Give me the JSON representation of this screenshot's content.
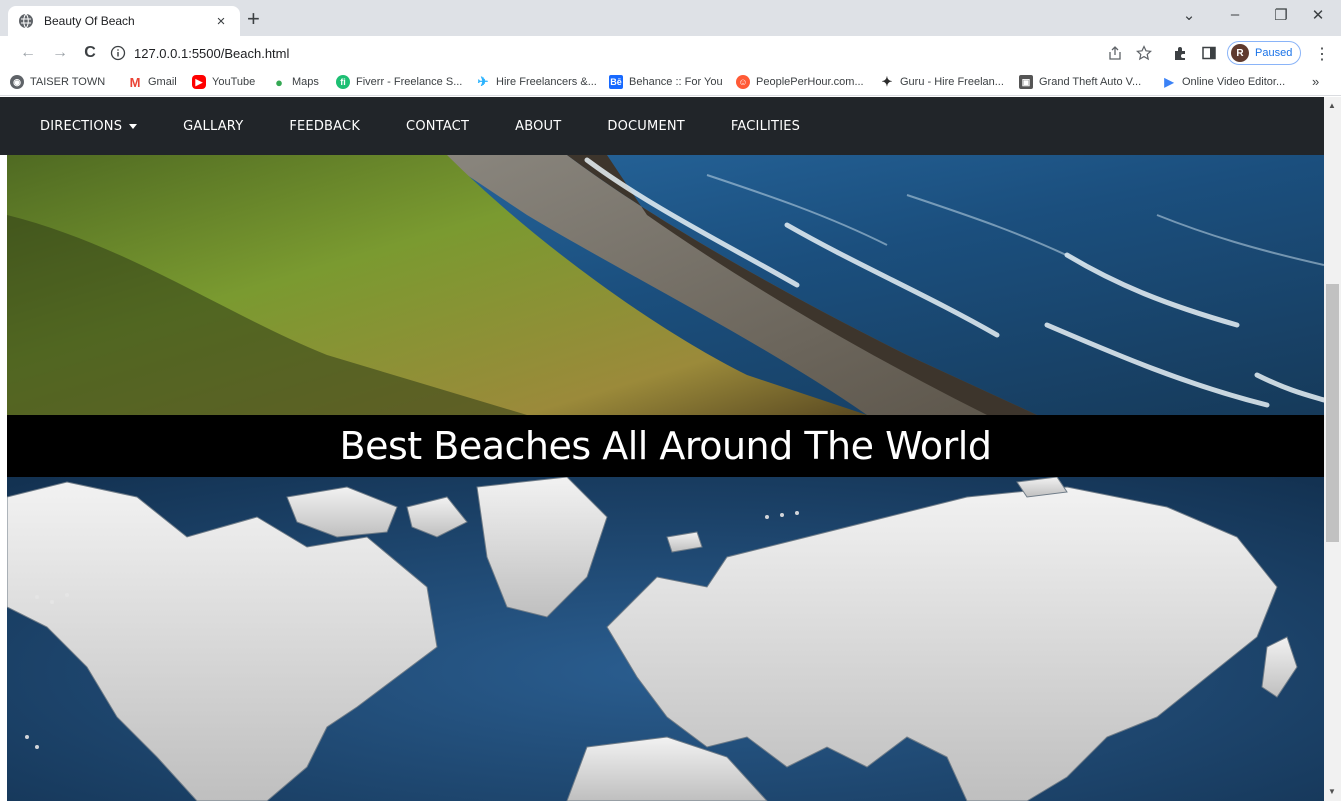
{
  "browser": {
    "tab_title": "Beauty Of Beach",
    "tab_close": "×",
    "new_tab": "+",
    "url": "127.0.0.1:5500/Beach.html",
    "profile_initial": "R",
    "profile_status": "Paused",
    "window_controls": {
      "dropdown": "⌄",
      "minimize": "–",
      "restore": "❐",
      "close": "✕"
    },
    "nav": {
      "back": "←",
      "forward": "→",
      "reload": "C"
    },
    "menu": "⋮",
    "bookmarks_more": "»"
  },
  "bookmarks": [
    {
      "label": "TAISER TOWN",
      "icon": "globe-icon",
      "color": "#5f6368"
    },
    {
      "label": "Gmail",
      "icon": "gmail-icon",
      "color": "#ea4335"
    },
    {
      "label": "YouTube",
      "icon": "youtube-icon",
      "color": "#ff0000"
    },
    {
      "label": "Maps",
      "icon": "maps-icon",
      "color": "#34a853"
    },
    {
      "label": "Fiverr - Freelance S...",
      "icon": "fiverr-icon",
      "color": "#1dbf73"
    },
    {
      "label": "Hire Freelancers &...",
      "icon": "freelancer-icon",
      "color": "#29b2fe"
    },
    {
      "label": "Behance :: For You",
      "icon": "behance-icon",
      "color": "#1769ff"
    },
    {
      "label": "PeoplePerHour.com...",
      "icon": "pph-icon",
      "color": "#ff5a36"
    },
    {
      "label": "Guru - Hire Freelan...",
      "icon": "guru-icon",
      "color": "#2c2c2c"
    },
    {
      "label": "Grand Theft Auto V...",
      "icon": "gta-icon",
      "color": "#555555"
    },
    {
      "label": "Online Video Editor...",
      "icon": "video-editor-icon",
      "color": "#3b82f6"
    }
  ],
  "site": {
    "nav": [
      {
        "label": "DIRECTIONS",
        "dropdown": true
      },
      {
        "label": "GALLARY"
      },
      {
        "label": "FEEDBACK"
      },
      {
        "label": "CONTACT"
      },
      {
        "label": "ABOUT"
      },
      {
        "label": "DOCUMENT"
      },
      {
        "label": "FACILITIES"
      }
    ],
    "banner_title": "Best Beaches All Around The World",
    "colors": {
      "nav_bg": "#212529",
      "banner_bg": "#000000",
      "ocean": "#1d4a78"
    }
  }
}
